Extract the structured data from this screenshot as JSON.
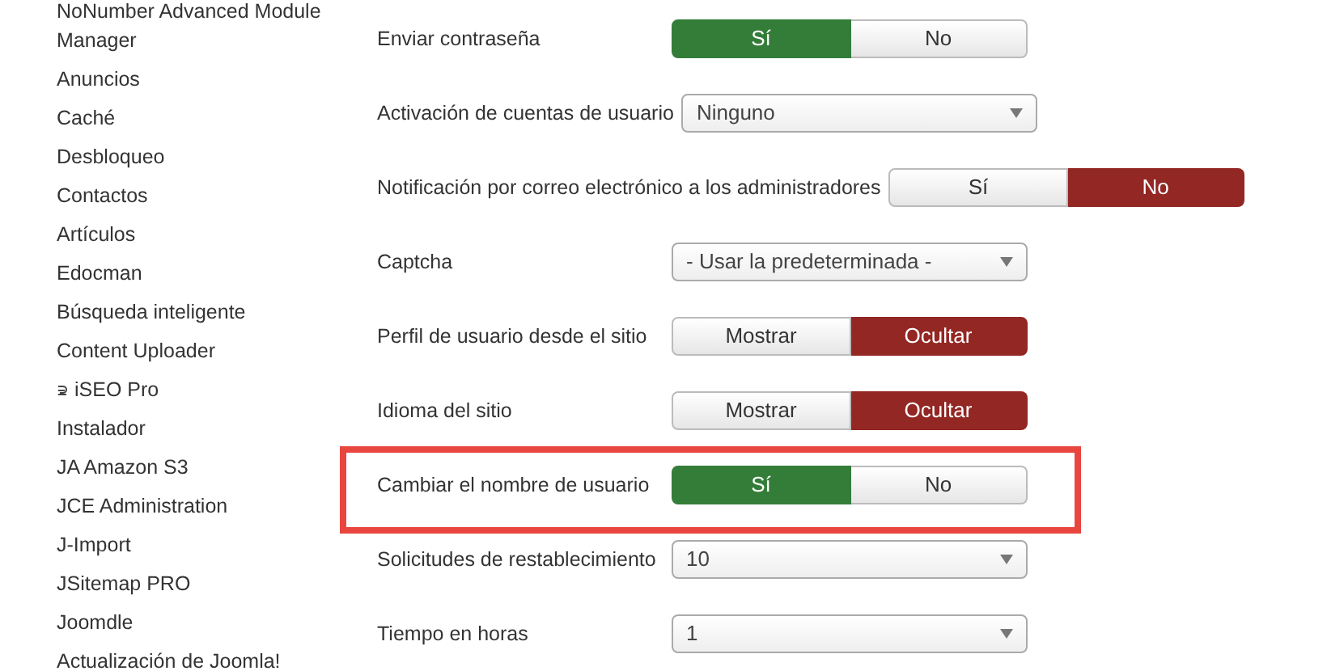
{
  "sidebar": {
    "items": [
      {
        "label": "NoNumber Advanced Module Manager"
      },
      {
        "label": "Anuncios"
      },
      {
        "label": "Caché"
      },
      {
        "label": "Desbloqueo"
      },
      {
        "label": "Contactos"
      },
      {
        "label": "Artículos"
      },
      {
        "label": "Edocman"
      },
      {
        "label": "Búsqueda inteligente"
      },
      {
        "label": "Content Uploader"
      },
      {
        "label": "iSEO Pro",
        "icon": true
      },
      {
        "label": "Instalador"
      },
      {
        "label": "JA Amazon S3"
      },
      {
        "label": "JCE Administration"
      },
      {
        "label": "J-Import"
      },
      {
        "label": "JSitemap PRO"
      },
      {
        "label": "Joomdle"
      },
      {
        "label": "Actualización de Joomla!"
      }
    ]
  },
  "settings": [
    {
      "kind": "toggle",
      "label": "Enviar contraseña",
      "options": [
        {
          "label": "Sí",
          "selected": true,
          "kind": "yes"
        },
        {
          "label": "No",
          "selected": false,
          "kind": "no"
        }
      ]
    },
    {
      "kind": "select",
      "label": "Activación de cuentas de usuario",
      "value": "Ninguno"
    },
    {
      "kind": "toggle",
      "label": "Notificación por correo electrónico a los administradores",
      "options": [
        {
          "label": "Sí",
          "selected": false,
          "kind": "yes"
        },
        {
          "label": "No",
          "selected": true,
          "kind": "no"
        }
      ]
    },
    {
      "kind": "select",
      "label": "Captcha",
      "value": "- Usar la predeterminada -"
    },
    {
      "kind": "toggle",
      "label": "Perfil de usuario desde el sitio",
      "options": [
        {
          "label": "Mostrar",
          "selected": false,
          "kind": "yes"
        },
        {
          "label": "Ocultar",
          "selected": true,
          "kind": "no"
        }
      ]
    },
    {
      "kind": "toggle",
      "label": "Idioma del sitio",
      "options": [
        {
          "label": "Mostrar",
          "selected": false,
          "kind": "yes"
        },
        {
          "label": "Ocultar",
          "selected": true,
          "kind": "no"
        }
      ]
    },
    {
      "kind": "toggle",
      "label": "Cambiar el nombre de usuario",
      "highlighted": true,
      "options": [
        {
          "label": "Sí",
          "selected": true,
          "kind": "yes"
        },
        {
          "label": "No",
          "selected": false,
          "kind": "no"
        }
      ]
    },
    {
      "kind": "select",
      "label": "Solicitudes de restablecimiento",
      "value": "10"
    },
    {
      "kind": "select",
      "label": "Tiempo en horas",
      "value": "1"
    }
  ]
}
